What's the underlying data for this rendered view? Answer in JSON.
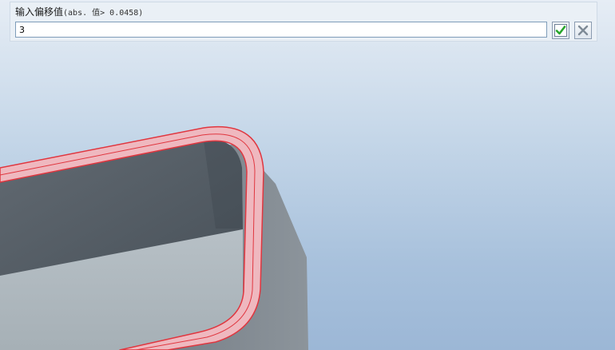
{
  "prompt": {
    "label": "输入偏移值",
    "hint": "(abs. 值> 0.0458)",
    "input_value": "3"
  },
  "buttons": {
    "accept_icon": "green-checkmark-icon",
    "cancel_icon": "grey-x-icon"
  },
  "colors": {
    "background_top": "#e6edf5",
    "background_bottom": "#9cb7d6",
    "model_gray": "#7b838b",
    "highlight_fill": "#efb8bf",
    "highlight_edge": "#e0363f",
    "accept_green": "#26a52b"
  }
}
